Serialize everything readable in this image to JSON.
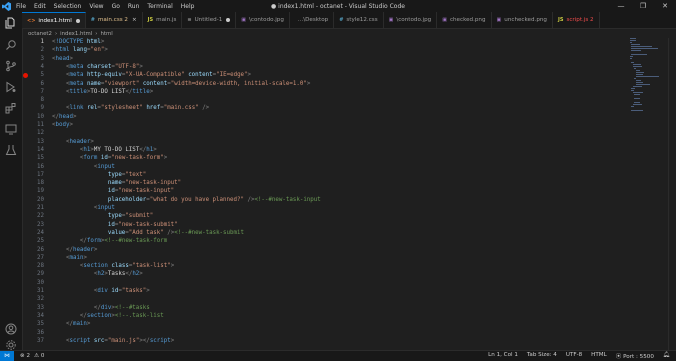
{
  "window": {
    "title": "● index1.html - octanet - Visual Studio Code",
    "menu": [
      "File",
      "Edit",
      "Selection",
      "View",
      "Go",
      "Run",
      "Terminal",
      "Help"
    ],
    "controls": [
      "—",
      "❐",
      "✕"
    ]
  },
  "tabs": [
    {
      "label": "index1.html",
      "icon_text": "<>",
      "icon_color": "#e37933",
      "state": "dirty",
      "active": true
    },
    {
      "label": "main.css 2",
      "icon_text": "#",
      "icon_color": "#519aba",
      "state": "close",
      "active": false,
      "label_color": "#e2c08d"
    },
    {
      "label": "main.js",
      "icon_text": "JS",
      "icon_color": "#cbcb41",
      "state": "none",
      "active": false
    },
    {
      "label": "Untitled-1",
      "icon_text": "≡",
      "icon_color": "#9d9d9d",
      "state": "dirty",
      "active": false
    },
    {
      "label": "\\contodo.jpg",
      "icon_text": "▣",
      "icon_color": "#a074c4",
      "state": "none",
      "active": false
    },
    {
      "label": "...\\Desktop",
      "icon_text": "",
      "icon_color": "#9d9d9d",
      "state": "none",
      "active": false
    },
    {
      "label": "style12.css",
      "icon_text": "#",
      "icon_color": "#519aba",
      "state": "none",
      "active": false
    },
    {
      "label": "\\contodo.jpg",
      "icon_text": "▣",
      "icon_color": "#a074c4",
      "state": "none",
      "active": false
    },
    {
      "label": "checked.png",
      "icon_text": "▣",
      "icon_color": "#a074c4",
      "state": "none",
      "active": false
    },
    {
      "label": "unchecked.png",
      "icon_text": "▣",
      "icon_color": "#a074c4",
      "state": "none",
      "active": false
    },
    {
      "label": "script.js 2",
      "icon_text": "JS",
      "icon_color": "#cbcb41",
      "state": "none",
      "active": false,
      "label_color": "#f14c4c"
    }
  ],
  "breadcrumb": [
    "octanet2",
    "index1.html",
    "html"
  ],
  "editor": {
    "lines": [
      [
        [
          "punc",
          "<"
        ],
        [
          "tag",
          "!DOCTYPE"
        ],
        [
          "text",
          " "
        ],
        [
          "attr",
          "html"
        ],
        [
          "punc",
          ">"
        ]
      ],
      [
        [
          "punc",
          "<"
        ],
        [
          "tag",
          "html"
        ],
        [
          "text",
          " "
        ],
        [
          "attr",
          "lang"
        ],
        [
          "punc",
          "="
        ],
        [
          "str",
          "\"en\""
        ],
        [
          "punc",
          ">"
        ]
      ],
      [
        [
          "punc",
          "<"
        ],
        [
          "tag",
          "head"
        ],
        [
          "punc",
          ">"
        ]
      ],
      [
        [
          "text",
          "    "
        ],
        [
          "punc",
          "<"
        ],
        [
          "tag",
          "meta"
        ],
        [
          "text",
          " "
        ],
        [
          "attr",
          "charset"
        ],
        [
          "punc",
          "="
        ],
        [
          "str",
          "\"UTF-8\""
        ],
        [
          "punc",
          ">"
        ]
      ],
      [
        [
          "text",
          "    "
        ],
        [
          "punc",
          "<"
        ],
        [
          "tag",
          "meta"
        ],
        [
          "text",
          " "
        ],
        [
          "attr",
          "http-equiv"
        ],
        [
          "punc",
          "="
        ],
        [
          "str",
          "\"X-UA-Compatible\""
        ],
        [
          "text",
          " "
        ],
        [
          "attr",
          "content"
        ],
        [
          "punc",
          "="
        ],
        [
          "str",
          "\"IE=edge\""
        ],
        [
          "punc",
          ">"
        ]
      ],
      [
        [
          "text",
          "    "
        ],
        [
          "punc",
          "<"
        ],
        [
          "tag",
          "meta"
        ],
        [
          "text",
          " "
        ],
        [
          "attr",
          "name"
        ],
        [
          "punc",
          "="
        ],
        [
          "str",
          "\"viewport\""
        ],
        [
          "text",
          " "
        ],
        [
          "attr",
          "content"
        ],
        [
          "punc",
          "="
        ],
        [
          "str",
          "\"width=device-width, initial-scale=1.0\""
        ],
        [
          "punc",
          ">"
        ]
      ],
      [
        [
          "text",
          "    "
        ],
        [
          "punc",
          "<"
        ],
        [
          "tag",
          "title"
        ],
        [
          "punc",
          ">"
        ],
        [
          "text",
          "TO-DO LIST"
        ],
        [
          "punc",
          "</"
        ],
        [
          "tag",
          "title"
        ],
        [
          "punc",
          ">"
        ]
      ],
      [],
      [
        [
          "text",
          "    "
        ],
        [
          "punc",
          "<"
        ],
        [
          "tag",
          "link"
        ],
        [
          "text",
          " "
        ],
        [
          "attr",
          "rel"
        ],
        [
          "punc",
          "="
        ],
        [
          "str",
          "\"stylesheet\""
        ],
        [
          "text",
          " "
        ],
        [
          "attr",
          "href"
        ],
        [
          "punc",
          "="
        ],
        [
          "str",
          "\"main.css\""
        ],
        [
          "text",
          " "
        ],
        [
          "punc",
          "/>"
        ]
      ],
      [
        [
          "punc",
          "</"
        ],
        [
          "tag",
          "head"
        ],
        [
          "punc",
          ">"
        ]
      ],
      [
        [
          "punc",
          "<"
        ],
        [
          "tag",
          "body"
        ],
        [
          "punc",
          ">"
        ]
      ],
      [],
      [
        [
          "text",
          "    "
        ],
        [
          "punc",
          "<"
        ],
        [
          "tag",
          "header"
        ],
        [
          "punc",
          ">"
        ]
      ],
      [
        [
          "text",
          "        "
        ],
        [
          "punc",
          "<"
        ],
        [
          "tag",
          "h1"
        ],
        [
          "punc",
          ">"
        ],
        [
          "text",
          "MY TO-DO LIST"
        ],
        [
          "punc",
          "</"
        ],
        [
          "tag",
          "h1"
        ],
        [
          "punc",
          ">"
        ]
      ],
      [
        [
          "text",
          "        "
        ],
        [
          "punc",
          "<"
        ],
        [
          "tag",
          "form"
        ],
        [
          "text",
          " "
        ],
        [
          "attr",
          "id"
        ],
        [
          "punc",
          "="
        ],
        [
          "str",
          "\"new-task-form\""
        ],
        [
          "punc",
          ">"
        ]
      ],
      [
        [
          "text",
          "            "
        ],
        [
          "punc",
          "<"
        ],
        [
          "tag",
          "input"
        ]
      ],
      [
        [
          "text",
          "                "
        ],
        [
          "attr",
          "type"
        ],
        [
          "punc",
          "="
        ],
        [
          "str",
          "\"text\""
        ]
      ],
      [
        [
          "text",
          "                "
        ],
        [
          "attr",
          "name"
        ],
        [
          "punc",
          "="
        ],
        [
          "str",
          "\"new-task-input\""
        ]
      ],
      [
        [
          "text",
          "                "
        ],
        [
          "attr",
          "id"
        ],
        [
          "punc",
          "="
        ],
        [
          "str",
          "\"new-task-input\""
        ]
      ],
      [
        [
          "text",
          "                "
        ],
        [
          "attr",
          "placeholder"
        ],
        [
          "punc",
          "="
        ],
        [
          "str",
          "\"what do you have planned?\""
        ],
        [
          "text",
          " "
        ],
        [
          "punc",
          "/>"
        ],
        [
          "cmt",
          "<!--#new-task-input"
        ]
      ],
      [
        [
          "text",
          "            "
        ],
        [
          "punc",
          "<"
        ],
        [
          "tag",
          "input"
        ]
      ],
      [
        [
          "text",
          "                "
        ],
        [
          "attr",
          "type"
        ],
        [
          "punc",
          "="
        ],
        [
          "str",
          "\"submit\""
        ]
      ],
      [
        [
          "text",
          "                "
        ],
        [
          "attr",
          "id"
        ],
        [
          "punc",
          "="
        ],
        [
          "str",
          "\"new-task-submit\""
        ]
      ],
      [
        [
          "text",
          "                "
        ],
        [
          "attr",
          "value"
        ],
        [
          "punc",
          "="
        ],
        [
          "str",
          "\"Add task\""
        ],
        [
          "text",
          " "
        ],
        [
          "punc",
          "/>"
        ],
        [
          "cmt",
          "<!--#new-task-submit"
        ]
      ],
      [
        [
          "text",
          "        "
        ],
        [
          "punc",
          "</"
        ],
        [
          "tag",
          "form"
        ],
        [
          "punc",
          ">"
        ],
        [
          "cmt",
          "<!--#new-task-form"
        ]
      ],
      [
        [
          "text",
          "    "
        ],
        [
          "punc",
          "</"
        ],
        [
          "tag",
          "header"
        ],
        [
          "punc",
          ">"
        ]
      ],
      [
        [
          "text",
          "    "
        ],
        [
          "punc",
          "<"
        ],
        [
          "tag",
          "main"
        ],
        [
          "punc",
          ">"
        ]
      ],
      [
        [
          "text",
          "        "
        ],
        [
          "punc",
          "<"
        ],
        [
          "tag",
          "section"
        ],
        [
          "text",
          " "
        ],
        [
          "attr",
          "class"
        ],
        [
          "punc",
          "="
        ],
        [
          "str",
          "\"task-list\""
        ],
        [
          "punc",
          ">"
        ]
      ],
      [
        [
          "text",
          "            "
        ],
        [
          "punc",
          "<"
        ],
        [
          "tag",
          "h2"
        ],
        [
          "punc",
          ">"
        ],
        [
          "text",
          "Tasks"
        ],
        [
          "punc",
          "</"
        ],
        [
          "tag",
          "h2"
        ],
        [
          "punc",
          ">"
        ]
      ],
      [],
      [
        [
          "text",
          "            "
        ],
        [
          "punc",
          "<"
        ],
        [
          "tag",
          "div"
        ],
        [
          "text",
          " "
        ],
        [
          "attr",
          "id"
        ],
        [
          "punc",
          "="
        ],
        [
          "str",
          "\"tasks\""
        ],
        [
          "punc",
          ">"
        ]
      ],
      [],
      [
        [
          "text",
          "            "
        ],
        [
          "punc",
          "</"
        ],
        [
          "tag",
          "div"
        ],
        [
          "punc",
          ">"
        ],
        [
          "cmt",
          "<!--#tasks"
        ]
      ],
      [
        [
          "text",
          "        "
        ],
        [
          "punc",
          "</"
        ],
        [
          "tag",
          "section"
        ],
        [
          "punc",
          ">"
        ],
        [
          "cmt",
          "<!--.task-list"
        ]
      ],
      [
        [
          "text",
          "    "
        ],
        [
          "punc",
          "</"
        ],
        [
          "tag",
          "main"
        ],
        [
          "punc",
          ">"
        ]
      ],
      [],
      [
        [
          "text",
          "    "
        ],
        [
          "punc",
          "<"
        ],
        [
          "tag",
          "script"
        ],
        [
          "text",
          " "
        ],
        [
          "attr",
          "src"
        ],
        [
          "punc",
          "="
        ],
        [
          "str",
          "\"main.js\""
        ],
        [
          "punc",
          "></"
        ],
        [
          "tag",
          "script"
        ],
        [
          "punc",
          ">"
        ]
      ]
    ],
    "current_line": 1,
    "breakpoint_line": 5
  },
  "statusbar": {
    "problems_errors": "⊗ 2",
    "problems_warnings": "⚠ 0",
    "cursor": "Ln 1, Col 1",
    "indent": "Tab Size: 4",
    "encoding": "UTF-8",
    "language": "HTML",
    "port": "⦿ Port : 5500",
    "remote": "⋈"
  },
  "colors": {
    "accent": "#0078d4",
    "background": "#1f1f1f",
    "chrome": "#181818"
  },
  "icons": {
    "activity": [
      "explorer-icon",
      "search-icon",
      "source-control-icon",
      "run-debug-icon",
      "extensions-icon",
      "remote-explorer-icon",
      "testing-icon",
      "account-icon",
      "settings-gear-icon"
    ]
  }
}
